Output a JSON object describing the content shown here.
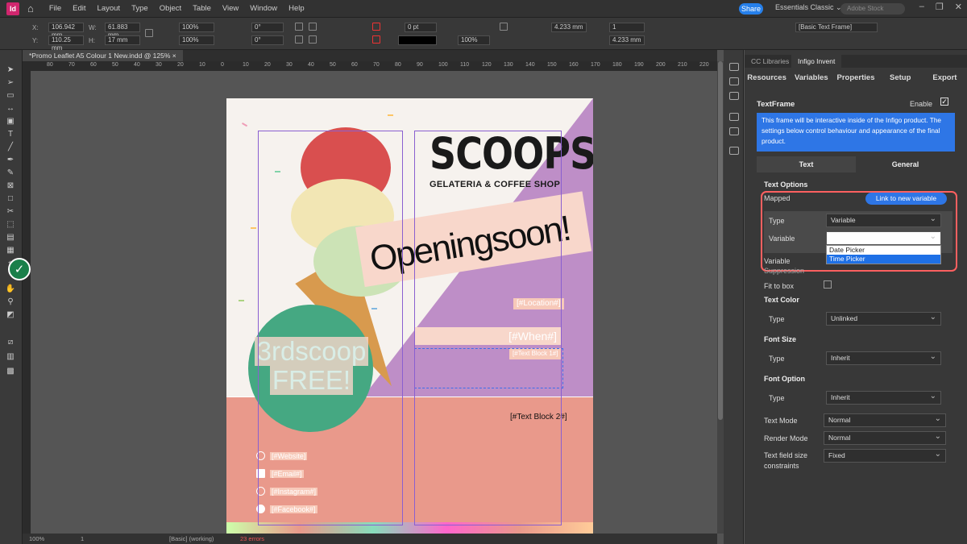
{
  "app": {
    "logo": "Id",
    "share": "Share",
    "workspace": "Essentials Classic ⌄",
    "stock_placeholder": "Adobe Stock"
  },
  "menubar": [
    "File",
    "Edit",
    "Layout",
    "Type",
    "Object",
    "Table",
    "View",
    "Window",
    "Help"
  ],
  "control": {
    "x": "106.942 mm",
    "y": "110.25 mm",
    "w": "61.883 mm",
    "h": "17 mm",
    "scale_x": "100%",
    "scale_y": "100%",
    "rotate": "0°",
    "shear": "0°",
    "stroke": "0 pt",
    "opacity": "100%",
    "dim1": "4.233 mm",
    "dim2": "4.233 mm",
    "cols": "1",
    "style": "[Basic Text Frame]"
  },
  "document": {
    "tab": "*Promo Leaflet A5 Colour 1 New.indd @ 125% ×"
  },
  "ruler_ticks": [
    "80",
    "70",
    "60",
    "50",
    "40",
    "30",
    "20",
    "10",
    "0",
    "10",
    "20",
    "30",
    "40",
    "50",
    "60",
    "70",
    "80",
    "90",
    "100",
    "110",
    "120",
    "130",
    "140",
    "150",
    "160",
    "170",
    "180",
    "190",
    "200",
    "210",
    "220",
    "230"
  ],
  "artwork": {
    "title": "SCOOPS",
    "subtitle": "GELATERIA & COFFEE SHOP",
    "banner": "Openingsoon!",
    "location": "[#Location#]",
    "when": "[#When#]",
    "textblock1": "[#Text Block 1#]",
    "textblock2": "[#Text Block 2#]",
    "free_line1": "3rdscoop",
    "free_line2": "FREE!",
    "website": "[#Website]",
    "email": "[#Email#]",
    "instagram": "[#Instagram#]",
    "facebook": "[#Facebook#]"
  },
  "status": {
    "zoom": "100%",
    "page": "1",
    "style": "[Basic] (working)",
    "errors": "23 errors"
  },
  "panel": {
    "tabs": [
      "CC Libraries",
      "Infigo Invent"
    ],
    "menu": [
      "Resources",
      "Variables",
      "Properties",
      "Setup",
      "Export"
    ],
    "frame_title": "TextFrame",
    "enable_label": "Enable",
    "info": "This frame will be interactive inside of the Infigo product. The settings below control behaviour and appearance of the final product.",
    "segment": [
      "Text",
      "General"
    ],
    "text_options": "Text Options",
    "mapped": "Mapped",
    "link_button": "Link to new variable",
    "type_label": "Type",
    "type_value": "Variable",
    "variable_label": "Variable",
    "variable_value": "",
    "options": [
      "Date Picker",
      "Time Picker"
    ],
    "variable_suppression_1": "Variable",
    "variable_suppression_2": "Suppression",
    "fit_to_box": "Fit to box",
    "text_color": "Text Color",
    "text_color_type": "Unlinked",
    "font_size": "Font Size",
    "font_size_type": "Inherit",
    "font_option": "Font Option",
    "font_option_type": "Inherit",
    "text_mode": "Text Mode",
    "text_mode_value": "Normal",
    "render_mode": "Render Mode",
    "render_mode_value": "Normal",
    "text_field_size": "Text field size",
    "constraints": "constraints",
    "text_field_size_value": "Fixed"
  }
}
